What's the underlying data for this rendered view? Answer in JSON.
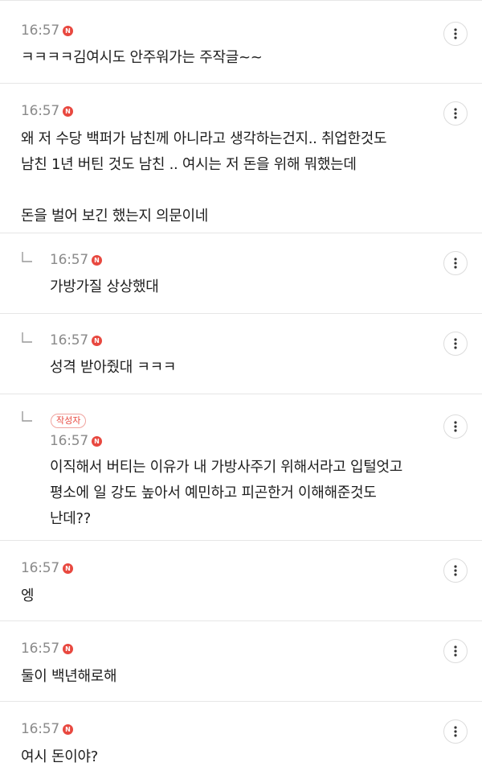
{
  "badges": {
    "new": "N",
    "author": "작성자"
  },
  "comments": [
    {
      "time": "16:57",
      "text": "ㅋㅋㅋㅋ김여시도 안주워가는 주작글~~"
    },
    {
      "time": "16:57",
      "text": "왜 저 수당 백퍼가 남친께 아니라고 생각하는건지.. 취업한것도\n남친 1년 버틴 것도 남친 .. 여시는 저 돈을 위해 뭐했는데\n\n돈을 벌어 보긴 했는지 의문이네"
    },
    {
      "time": "16:57",
      "text": "가방가질 상상했대",
      "reply": true
    },
    {
      "time": "16:57",
      "text": "성격 받아줬대 ㅋㅋㅋ",
      "reply": true
    },
    {
      "time": "16:57",
      "text": "이직해서 버티는 이유가 내 가방사주기 위해서라고 입털엇고\n평소에 일 강도 높아서 예민하고 피곤한거 이해해준것도\n난데??",
      "reply": true,
      "author": true
    },
    {
      "time": "16:57",
      "text": "엥"
    },
    {
      "time": "16:57",
      "text": "둘이 백년해로해"
    },
    {
      "time": "16:57",
      "text": "여시 돈이야?"
    }
  ]
}
